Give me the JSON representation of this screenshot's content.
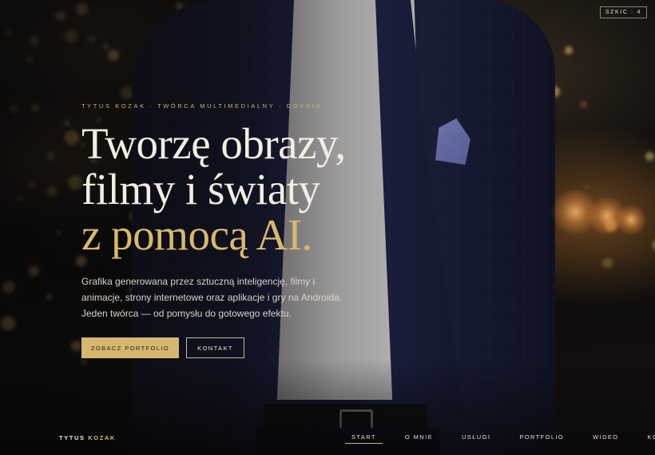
{
  "badge": "SZKIC · 4",
  "hero": {
    "eyebrow": "TYTUS KOZAK · TWÓRCA MULTIMEDIALNY · GDYNIA",
    "headline_line1": "Tworzę obrazy,",
    "headline_line2": "filmy i światy",
    "headline_line3": "z pomocą AI.",
    "lead_line1": "Grafika generowana przez sztuczną inteligencję, filmy i",
    "lead_line2": "animacje, strony internetowe oraz aplikacje i gry na Androida.",
    "lead_line3": "Jeden twórca — od pomysłu do gotowego efektu.",
    "primary_button": "ZOBACZ PORTFOLIO",
    "secondary_button": "KONTAKT"
  },
  "footer": {
    "brand_first": "TYTUS",
    "brand_second": "KOZAK",
    "nav": [
      {
        "label": "START",
        "active": true
      },
      {
        "label": "O MNIE",
        "active": false
      },
      {
        "label": "USŁUGI",
        "active": false
      },
      {
        "label": "PORTFOLIO",
        "active": false
      },
      {
        "label": "WIDEO",
        "active": false
      },
      {
        "label": "KONTAKT",
        "active": false
      }
    ]
  },
  "colors": {
    "accent_gold": "#d7b76f",
    "background": "#0c0b0c",
    "text": "#f3ede2"
  }
}
